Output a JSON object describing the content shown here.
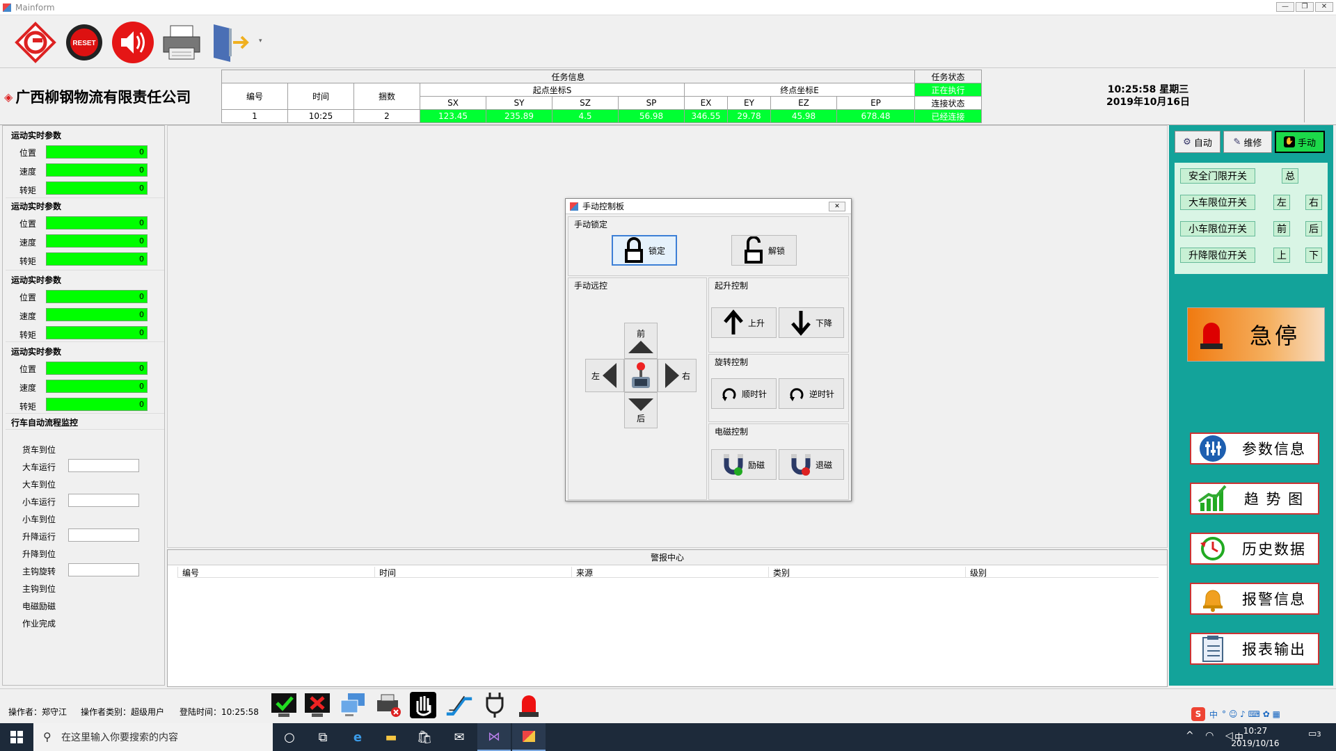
{
  "window": {
    "title": "Mainform",
    "min": "—",
    "max": "❐",
    "close": "✕"
  },
  "toolbar": {
    "icons": [
      "logo-icon",
      "reset-icon",
      "speaker-icon",
      "printer-icon",
      "exit-icon"
    ],
    "reset_label": "RESET"
  },
  "company": "广西柳钢物流有限责任公司",
  "task": {
    "section_title": "任务信息",
    "status_title": "任务状态",
    "headers": {
      "id": "编号",
      "time": "时间",
      "count": "捆数",
      "start": "起点坐标S",
      "end": "终点坐标E"
    },
    "coord_headers": [
      "SX",
      "SY",
      "SZ",
      "SP",
      "EX",
      "EY",
      "EZ",
      "EP"
    ],
    "row": {
      "id": "1",
      "time": "10:25",
      "count": "2"
    },
    "coords": [
      "123.45",
      "235.89",
      "4.5",
      "56.98",
      "346.55",
      "29.78",
      "45.98",
      "678.48"
    ],
    "status": [
      "正在执行",
      "连接状态",
      "已经连接"
    ]
  },
  "datetime": {
    "line1": "10:25:58 星期三",
    "line2": "2019年10月16日"
  },
  "left": {
    "groups": [
      {
        "title": "运动实时参数",
        "params": [
          {
            "label": "位置",
            "value": "0"
          },
          {
            "label": "速度",
            "value": "0"
          },
          {
            "label": "转矩",
            "value": "0"
          }
        ]
      },
      {
        "title": "运动实时参数",
        "params": [
          {
            "label": "位置",
            "value": "0"
          },
          {
            "label": "速度",
            "value": "0"
          },
          {
            "label": "转矩",
            "value": "0"
          }
        ]
      },
      {
        "title": "运动实时参数",
        "params": [
          {
            "label": "位置",
            "value": "0"
          },
          {
            "label": "速度",
            "value": "0"
          },
          {
            "label": "转矩",
            "value": "0"
          }
        ]
      },
      {
        "title": "运动实时参数",
        "params": [
          {
            "label": "位置",
            "value": "0"
          },
          {
            "label": "速度",
            "value": "0"
          },
          {
            "label": "转矩",
            "value": "0"
          }
        ]
      }
    ],
    "flow_title": "行车自动流程监控",
    "flow": [
      "货车到位",
      "大车运行",
      "大车到位",
      "小车运行",
      "小车到位",
      "升降运行",
      "升降到位",
      "主钩旋转",
      "主钩到位",
      "电磁励磁",
      "作业完成"
    ]
  },
  "dialog": {
    "title": "手动控制板",
    "close": "✕",
    "lock_group": "手动锁定",
    "lock": "锁定",
    "unlock": "解锁",
    "remote_group": "手动远控",
    "front": "前",
    "back": "后",
    "left": "左",
    "right": "右",
    "lift_group": "起升控制",
    "up": "上升",
    "down": "下降",
    "rotate_group": "旋转控制",
    "cw": "顺时针",
    "ccw": "逆时针",
    "magnet_group": "电磁控制",
    "excite": "励磁",
    "demag": "退磁"
  },
  "alarm": {
    "title": "警报中心",
    "columns": [
      "编号",
      "时间",
      "来源",
      "类别",
      "级别"
    ]
  },
  "right": {
    "modes": [
      "自动",
      "维修",
      "手动"
    ],
    "limits": [
      {
        "label": "安全门限开关",
        "a": "总"
      },
      {
        "label": "大车限位开关",
        "a": "左",
        "b": "右"
      },
      {
        "label": "小车限位开关",
        "a": "前",
        "b": "后"
      },
      {
        "label": "升降限位开关",
        "a": "上",
        "b": "下"
      }
    ],
    "estop": "急停",
    "nav": [
      "参数信息",
      "趋 势 图",
      "历史数据",
      "报警信息",
      "报表输出"
    ]
  },
  "status": {
    "operator": "操作者：郑守江",
    "type": "操作者类别：超级用户",
    "login": "登陆时间：10:25:58"
  },
  "taskbar": {
    "search_placeholder": "在这里输入你要搜索的内容",
    "time": "10:27",
    "date": "2019/10/16",
    "ime": "中",
    "notif": "3"
  },
  "colors": {
    "green": "#00ff00",
    "teal": "#13a39a",
    "accent": "#3c7fd6"
  }
}
